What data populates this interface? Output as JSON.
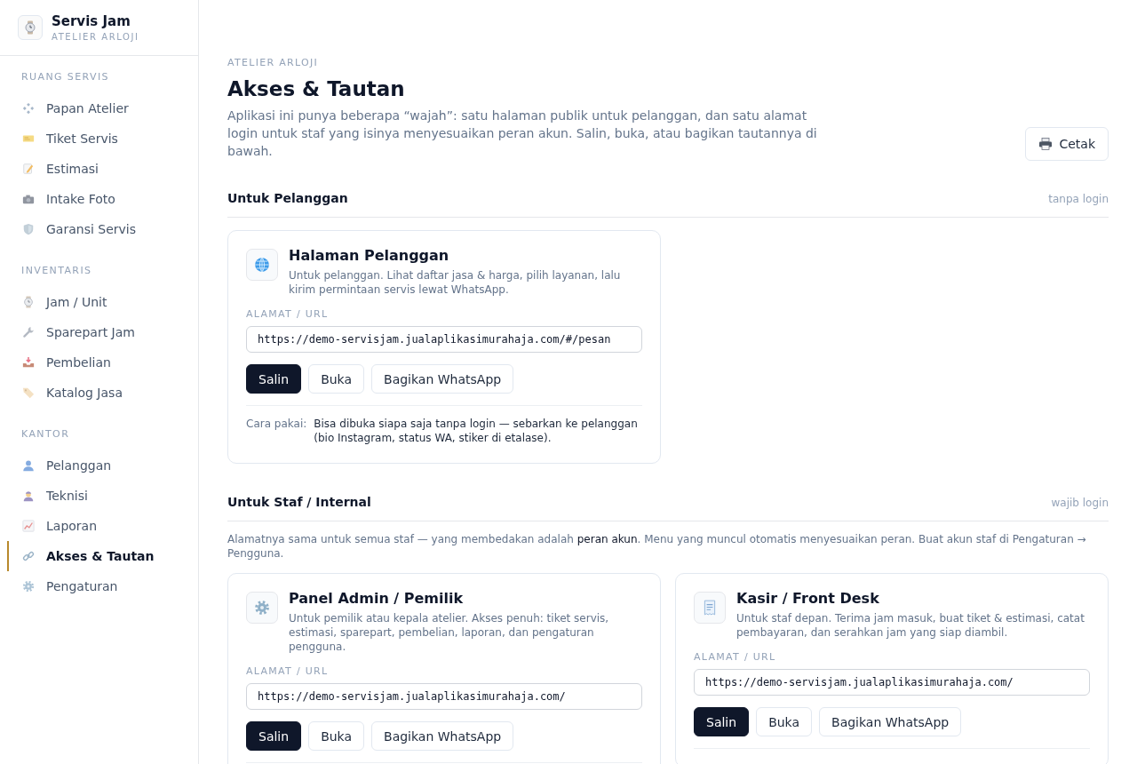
{
  "sidebar": {
    "brand": {
      "title": "Servis Jam",
      "subtitle": "ATELIER ARLOJI"
    },
    "groups": [
      {
        "label": "RUANG SERVIS",
        "items": [
          {
            "label": "Papan Atelier",
            "selected": false
          },
          {
            "label": "Tiket Servis",
            "selected": false
          },
          {
            "label": "Estimasi",
            "selected": false
          },
          {
            "label": "Intake Foto",
            "selected": false
          },
          {
            "label": "Garansi Servis",
            "selected": false
          }
        ]
      },
      {
        "label": "INVENTARIS",
        "items": [
          {
            "label": "Jam / Unit",
            "selected": false
          },
          {
            "label": "Sparepart Jam",
            "selected": false
          },
          {
            "label": "Pembelian",
            "selected": false
          },
          {
            "label": "Katalog Jasa",
            "selected": false
          }
        ]
      },
      {
        "label": "KANTOR",
        "items": [
          {
            "label": "Pelanggan",
            "selected": false
          },
          {
            "label": "Teknisi",
            "selected": false
          },
          {
            "label": "Laporan",
            "selected": false
          },
          {
            "label": "Akses & Tautan",
            "selected": true
          },
          {
            "label": "Pengaturan",
            "selected": false
          }
        ]
      }
    ]
  },
  "header": {
    "eyebrow": "ATELIER ARLOJI",
    "title": "Akses & Tautan",
    "description": "Aplikasi ini punya beberapa “wajah”: satu halaman publik untuk pelanggan, dan satu alamat login untuk staf yang isinya menyesuaikan peran akun. Salin, buka, atau bagikan tautannya di bawah.",
    "print_button": "Cetak"
  },
  "sections": [
    {
      "title": "Untuk Pelanggan",
      "tag": "tanpa login",
      "cards": [
        {
          "title": "Halaman Pelanggan",
          "description": "Untuk pelanggan. Lihat daftar jasa & harga, pilih layanan, lalu kirim permintaan servis lewat WhatsApp.",
          "url_label": "ALAMAT / URL",
          "url": "https://demo-servisjam.jualaplikasimurahaja.com/#/pesan",
          "buttons": [
            {
              "label": "Salin",
              "kind": "primary"
            },
            {
              "label": "Buka",
              "kind": "secondary"
            },
            {
              "label": "Bagikan WhatsApp",
              "kind": "secondary"
            }
          ],
          "usage": {
            "label": "Cara pakai:",
            "text": "Bisa dibuka siapa saja tanpa login — sebarkan ke pelanggan (bio Instagram, status WA, stiker di etalase)."
          }
        }
      ]
    },
    {
      "title": "Untuk Staf / Internal",
      "tag": "wajib login",
      "note": "Alamatnya sama untuk semua staf — yang membedakan adalah **peran akun**. Menu yang muncul otomatis menyesuaikan peran. Buat akun staf di Pengaturan → Pengguna.",
      "cards": [
        {
          "title": "Panel Admin / Pemilik",
          "description": "Untuk pemilik atau kepala atelier. Akses penuh: tiket servis, estimasi, sparepart, pembelian, laporan, dan pengaturan pengguna.",
          "url_label": "ALAMAT / URL",
          "url": "https://demo-servisjam.jualaplikasimurahaja.com/",
          "buttons": [
            {
              "label": "Salin",
              "kind": "primary"
            },
            {
              "label": "Buka",
              "kind": "secondary"
            },
            {
              "label": "Bagikan WhatsApp",
              "kind": "secondary"
            }
          ]
        },
        {
          "title": "Kasir / Front Desk",
          "description": "Untuk staf depan. Terima jam masuk, buat tiket & estimasi, catat pembayaran, dan serahkan jam yang siap diambil.",
          "url_label": "ALAMAT / URL",
          "url": "https://demo-servisjam.jualaplikasimurahaja.com/",
          "buttons": [
            {
              "label": "Salin",
              "kind": "primary"
            },
            {
              "label": "Buka",
              "kind": "secondary"
            },
            {
              "label": "Bagikan WhatsApp",
              "kind": "secondary"
            }
          ]
        }
      ]
    }
  ]
}
